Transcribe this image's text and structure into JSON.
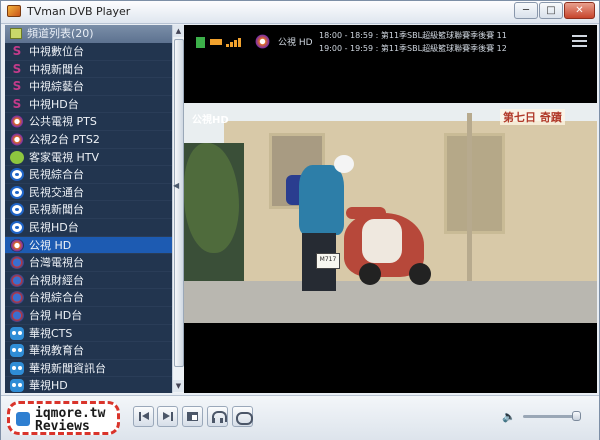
{
  "window": {
    "title": "TVman DVB Player"
  },
  "titlebar_buttons": {
    "minimize": "─",
    "maximize": "□",
    "close": "✕"
  },
  "sidebar": {
    "header": "頻道列表(20)",
    "channels": [
      {
        "name": "中視數位台",
        "icon": "s-icon"
      },
      {
        "name": "中視新聞台",
        "icon": "s-icon"
      },
      {
        "name": "中視綜藝台",
        "icon": "s-icon"
      },
      {
        "name": "中視HD台",
        "icon": "s-icon"
      },
      {
        "name": "公共電視 PTS",
        "icon": "pts-icon"
      },
      {
        "name": "公視2台 PTS2",
        "icon": "pts-icon"
      },
      {
        "name": "客家電視 HTV",
        "icon": "hakka-icon"
      },
      {
        "name": "民視綜合台",
        "icon": "eye-icon"
      },
      {
        "name": "民視交通台",
        "icon": "eye-icon"
      },
      {
        "name": "民視新聞台",
        "icon": "eye-icon"
      },
      {
        "name": "民視HD台",
        "icon": "eye-icon"
      },
      {
        "name": "公視 HD",
        "icon": "pts-icon",
        "selected": true
      },
      {
        "name": "台灣電視台",
        "icon": "ttv-icon"
      },
      {
        "name": "台視財經台",
        "icon": "ttv-icon"
      },
      {
        "name": "台視綜合台",
        "icon": "ttv-icon"
      },
      {
        "name": "台視 HD台",
        "icon": "ttv-icon"
      },
      {
        "name": "華視CTS",
        "icon": "cts-icon"
      },
      {
        "name": "華視教育台",
        "icon": "cts-icon"
      },
      {
        "name": "華視新聞資訊台",
        "icon": "cts-icon"
      },
      {
        "name": "華視HD",
        "icon": "cts-icon"
      }
    ]
  },
  "osd": {
    "channel": "公視 HD",
    "epg_now": "18:00 - 18:59 : 第11季SBL超級籃球聯賽季後賽 11",
    "epg_next": "19:00 - 19:59 : 第11季SBL超級籃球聯賽季後賽 12"
  },
  "video": {
    "channel_logo": "公視HD",
    "program_title": "第七日 奇蹟",
    "plate": "M717"
  },
  "watermark": {
    "line1": "iqmore.tw",
    "line2": "Reviews"
  },
  "volume": {
    "level": 0.93
  },
  "colors": {
    "selected_row": "#1d5bb2",
    "list_bg": "#22354f"
  }
}
